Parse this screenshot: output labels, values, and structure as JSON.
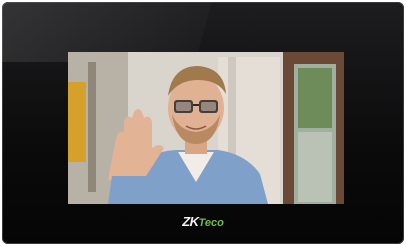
{
  "brand": {
    "part1": "ZK",
    "part2": "Teco",
    "part1_color": "#f2f2f2",
    "part2_color": "#6cc04a"
  },
  "device": {
    "bezel_color": "#111112",
    "screen_content": "video-call-person-waving"
  }
}
